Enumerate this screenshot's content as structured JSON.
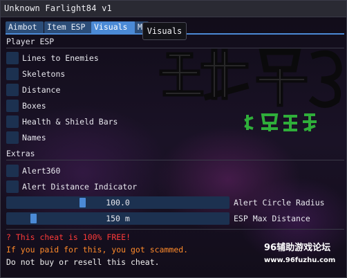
{
  "window": {
    "title": "Unknown Farlight84 v1"
  },
  "tabs": [
    {
      "label": "Aimbot"
    },
    {
      "label": "Item ESP"
    },
    {
      "label": "Visuals"
    },
    {
      "label": "M"
    }
  ],
  "tooltip": {
    "text": "Visuals"
  },
  "player_esp": {
    "heading": "Player ESP",
    "options": [
      {
        "label": "Lines to Enemies",
        "checked": false
      },
      {
        "label": "Skeletons",
        "checked": false
      },
      {
        "label": "Distance",
        "checked": false
      },
      {
        "label": "Boxes",
        "checked": false
      },
      {
        "label": "Health & Shield Bars",
        "checked": false
      },
      {
        "label": "Names",
        "checked": false
      }
    ]
  },
  "extras": {
    "heading": "Extras",
    "options": [
      {
        "label": "Alert360",
        "checked": false
      },
      {
        "label": "Alert Distance Indicator",
        "checked": false
      }
    ],
    "sliders": [
      {
        "value_text": "100.0",
        "label": "Alert Circle Radius"
      },
      {
        "value_text": "150 m",
        "label": "ESP Max Distance"
      }
    ]
  },
  "notices": {
    "free": "? This cheat is 100% FREE!",
    "scam": "If you paid for this, you got scammed.",
    "resell": "Do not buy or resell this cheat."
  },
  "watermark": {
    "site_name": "96辅助游戏论坛",
    "site_url": "www.96fuzhu.com",
    "logo_text": "远光84",
    "sub_text": "水墨金锁"
  },
  "colors": {
    "accent": "#4b8ad6",
    "frame_bg": "#1c3150",
    "warning_red": "#ff3a3a",
    "warning_orange": "#ff8a2a"
  }
}
